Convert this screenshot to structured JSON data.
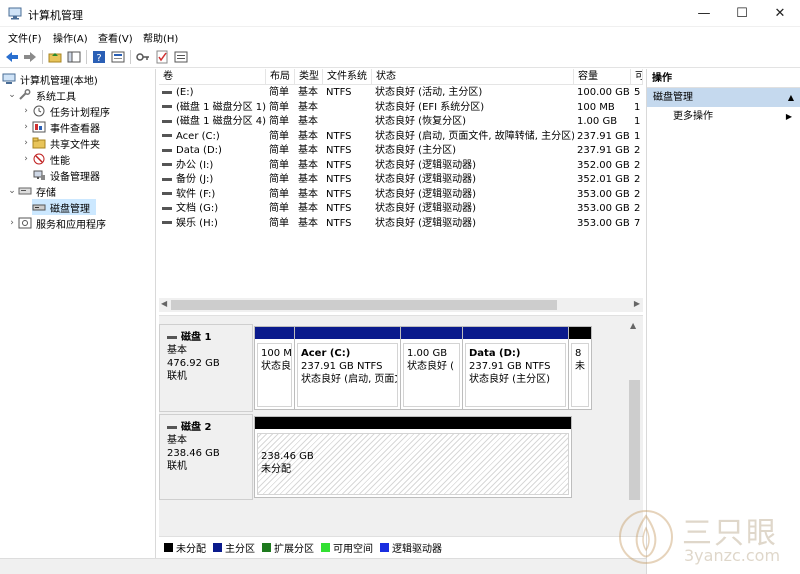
{
  "window": {
    "title": "计算机管理",
    "controls": {
      "minimize": "—",
      "maximize": "☐",
      "close": "✕"
    }
  },
  "menubar": [
    "文件(F)",
    "操作(A)",
    "查看(V)",
    "帮助(H)"
  ],
  "tree": {
    "root": "计算机管理(本地)",
    "items": [
      {
        "label": "系统工具"
      },
      {
        "label": "任务计划程序"
      },
      {
        "label": "事件查看器"
      },
      {
        "label": "共享文件夹"
      },
      {
        "label": "性能"
      },
      {
        "label": "设备管理器"
      },
      {
        "label": "存储"
      },
      {
        "label": "磁盘管理"
      },
      {
        "label": "服务和应用程序"
      }
    ]
  },
  "volumes": {
    "columns": [
      "卷",
      "布局",
      "类型",
      "文件系统",
      "状态",
      "容量",
      "可"
    ],
    "rows": [
      [
        "(E:)",
        "简单",
        "基本",
        "NTFS",
        "状态良好 (活动, 主分区)",
        "100.00 GB",
        "5"
      ],
      [
        "(磁盘 1 磁盘分区 1)",
        "简单",
        "基本",
        "",
        "状态良好 (EFI 系统分区)",
        "100 MB",
        "1"
      ],
      [
        "(磁盘 1 磁盘分区 4)",
        "简单",
        "基本",
        "",
        "状态良好 (恢复分区)",
        "1.00 GB",
        "1"
      ],
      [
        "Acer (C:)",
        "简单",
        "基本",
        "NTFS",
        "状态良好 (启动, 页面文件, 故障转储, 主分区)",
        "237.91 GB",
        "1"
      ],
      [
        "Data (D:)",
        "简单",
        "基本",
        "NTFS",
        "状态良好 (主分区)",
        "237.91 GB",
        "2"
      ],
      [
        "办公 (I:)",
        "简单",
        "基本",
        "NTFS",
        "状态良好 (逻辑驱动器)",
        "352.00 GB",
        "2"
      ],
      [
        "备份 (J:)",
        "简单",
        "基本",
        "NTFS",
        "状态良好 (逻辑驱动器)",
        "352.01 GB",
        "2"
      ],
      [
        "软件 (F:)",
        "简单",
        "基本",
        "NTFS",
        "状态良好 (逻辑驱动器)",
        "353.00 GB",
        "2"
      ],
      [
        "文档 (G:)",
        "简单",
        "基本",
        "NTFS",
        "状态良好 (逻辑驱动器)",
        "353.00 GB",
        "2"
      ],
      [
        "娱乐 (H:)",
        "简单",
        "基本",
        "NTFS",
        "状态良好 (逻辑驱动器)",
        "353.00 GB",
        "7"
      ]
    ]
  },
  "disks": {
    "disk1": {
      "name": "磁盘 1",
      "type": "基本",
      "size": "476.92 GB",
      "state": "联机",
      "partitions": [
        {
          "name": "",
          "size": "100 M",
          "status": "状态良"
        },
        {
          "name": "Acer  (C:)",
          "size": "237.91 GB NTFS",
          "status": "状态良好 (启动, 页面文"
        },
        {
          "name": "",
          "size": "1.00 GB",
          "status": "状态良好 ("
        },
        {
          "name": "Data  (D:)",
          "size": "237.91 GB NTFS",
          "status": "状态良好 (主分区)"
        },
        {
          "name": "",
          "size": "8",
          "status": "未"
        }
      ]
    },
    "disk2": {
      "name": "磁盘 2",
      "type": "基本",
      "size": "238.46 GB",
      "state": "联机",
      "partitions": [
        {
          "size": "238.46 GB",
          "status": "未分配"
        }
      ]
    }
  },
  "legend": [
    {
      "label": "未分配",
      "color": "#000000"
    },
    {
      "label": "主分区",
      "color": "#0a1a8c"
    },
    {
      "label": "扩展分区",
      "color": "#1e7a1e"
    },
    {
      "label": "可用空间",
      "color": "#33e033"
    },
    {
      "label": "逻辑驱动器",
      "color": "#1a2ee0"
    }
  ],
  "actions": {
    "header": "操作",
    "section": "磁盘管理",
    "more": "更多操作"
  },
  "watermark": {
    "brand": "三只眼",
    "url": "3yanzc.com"
  }
}
